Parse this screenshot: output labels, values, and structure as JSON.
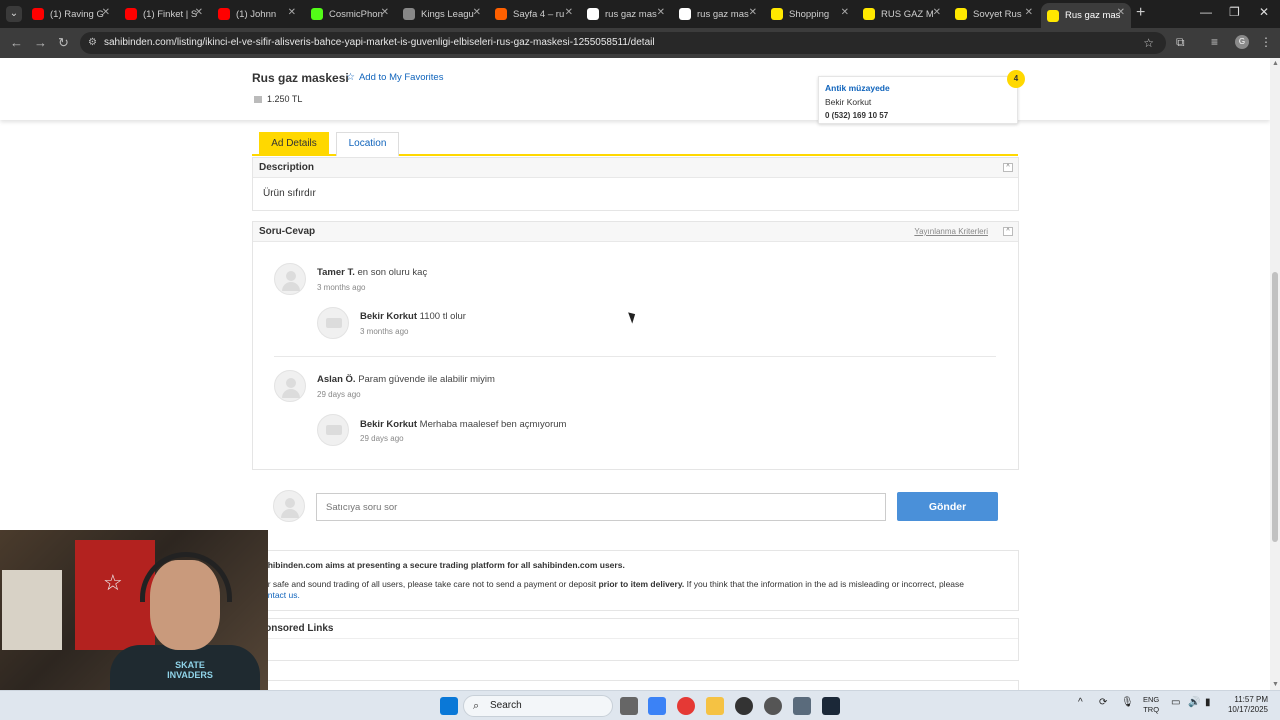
{
  "browser": {
    "tabs": [
      {
        "label": "(1) Raving G",
        "favicon": "youtube-icon",
        "color": "#ff0000"
      },
      {
        "label": "(1) Finket | S",
        "favicon": "youtube-icon",
        "color": "#ff0000"
      },
      {
        "label": "(1) Johnn",
        "favicon": "youtube-icon",
        "color": "#ff0000"
      },
      {
        "label": "CosmicPhon",
        "favicon": "kick-icon",
        "color": "#53fc18"
      },
      {
        "label": "Kings Leagu",
        "favicon": "globe-icon",
        "color": "#888888"
      },
      {
        "label": "Sayfa 4 – ru",
        "favicon": "hb-icon",
        "color": "#ff6000"
      },
      {
        "label": "rus gaz mas",
        "favicon": "google-icon",
        "color": "#ffffff"
      },
      {
        "label": "rus gaz mas",
        "favicon": "google-icon",
        "color": "#ffffff"
      },
      {
        "label": "Shopping",
        "favicon": "sahibinden-icon",
        "color": "#ffe800"
      },
      {
        "label": "RUS GAZ M",
        "favicon": "sahibinden-icon",
        "color": "#ffe800"
      },
      {
        "label": "Sovyet Rus",
        "favicon": "sahibinden-icon",
        "color": "#ffe800"
      },
      {
        "label": "Rus gaz mas",
        "favicon": "sahibinden-icon",
        "color": "#ffe800"
      }
    ],
    "url": "sahibinden.com/listing/ikinci-el-ve-sifir-alisveris-bahce-yapi-market-is-guvenligi-elbiseleri-rus-gaz-maskesi-1255058511/detail"
  },
  "listing": {
    "title": "Rus gaz maskesi",
    "favorites_label": "Add to My Favorites",
    "price": "1.250 TL"
  },
  "seller": {
    "shop_name": "Antik müzayede",
    "name": "Bekir Korkut",
    "phone": "0 (532) 169 10 57",
    "years_badge": "4"
  },
  "tabs": {
    "details": "Ad Details",
    "location": "Location"
  },
  "description": {
    "heading": "Description",
    "text": "Ürün sıfırdır"
  },
  "qa": {
    "heading": "Soru-Cevap",
    "criteria_link": "Yayınlanma Kriterleri",
    "threads": [
      {
        "q_user": "Tamer T.",
        "q_text": "en son oluru kaç",
        "q_time": "3 months ago",
        "a_user": "Bekir Korkut",
        "a_text": "1100 tl olur",
        "a_time": "3 months ago"
      },
      {
        "q_user": "Aslan Ö.",
        "q_text": "Param güvende ile alabilir miyim",
        "q_time": "29 days ago",
        "a_user": "Bekir Korkut",
        "a_text": "Merhaba maalesef ben açmıyorum",
        "a_time": "29 days ago"
      }
    ],
    "input_placeholder": "Satıcıya soru sor",
    "send_label": "Gönder"
  },
  "info": {
    "headline": "ahibinden.com aims at presenting a secure trading platform for all sahibinden.com users.",
    "body_start": "or safe and sound trading of all users, please take care not to send a payment or deposit ",
    "body_bold": "prior to item delivery.",
    "body_end": " If you think that the information in the ad is misleading or incorrect, please",
    "contact": "ontact us."
  },
  "sponsored": {
    "heading": "ponsored Links"
  },
  "taskbar": {
    "search_label": "Search",
    "lang_top": "ENG",
    "lang_bottom": "TRQ",
    "time": "11:57 PM",
    "date": "10/17/2025"
  },
  "webcam": {
    "shirt_text": "SKATE INVADERS"
  }
}
